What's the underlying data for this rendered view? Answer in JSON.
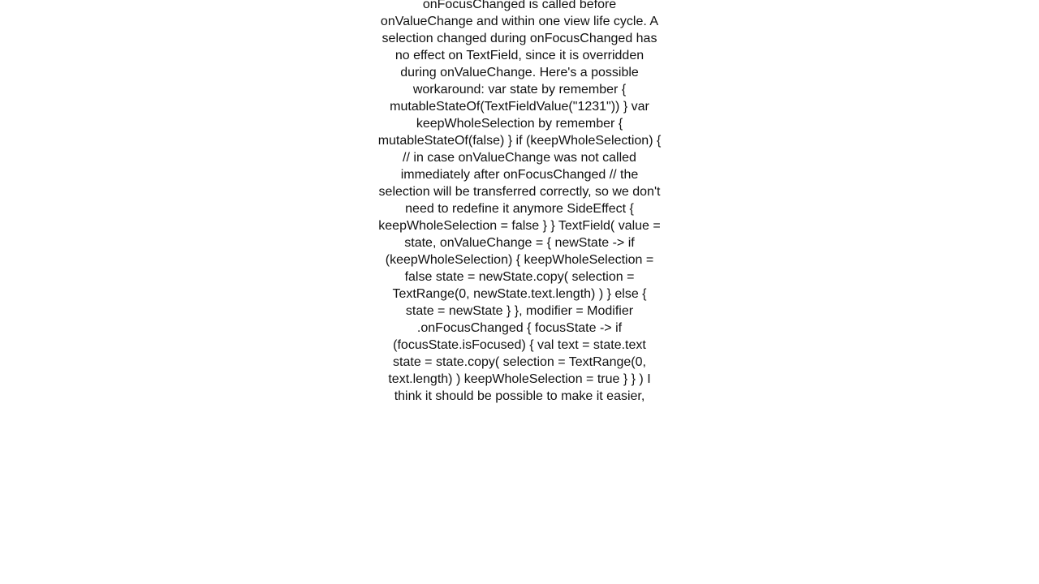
{
  "content": {
    "text": "onFocusChanged is called before onValueChange and within one view life cycle. A selection changed during onFocusChanged has no effect on TextField, since it is overridden during onValueChange. Here's a possible workaround: var state by remember { mutableStateOf(TextFieldValue(\"1231\")) } var keepWholeSelection by remember { mutableStateOf(false) } if (keepWholeSelection) {     // in case onValueChange was not called immediately after onFocusChanged     // the selection will be transferred correctly, so we don't need to redefine it anymore     SideEffect {         keepWholeSelection = false     } } TextField(     value = state,     onValueChange = { newState ->         if (keepWholeSelection) {             keepWholeSelection = false             state = newState.copy(                 selection = TextRange(0, newState.text.length)             )         } else {             state = newState         }     },     modifier = Modifier         .onFocusChanged { focusState ->             if (focusState.isFocused) {                 val text = state.text                 state = state.copy(                     selection = TextRange(0, text.length)                 )                 keepWholeSelection = true             }         } )  I think it should be possible to make it easier,"
  }
}
